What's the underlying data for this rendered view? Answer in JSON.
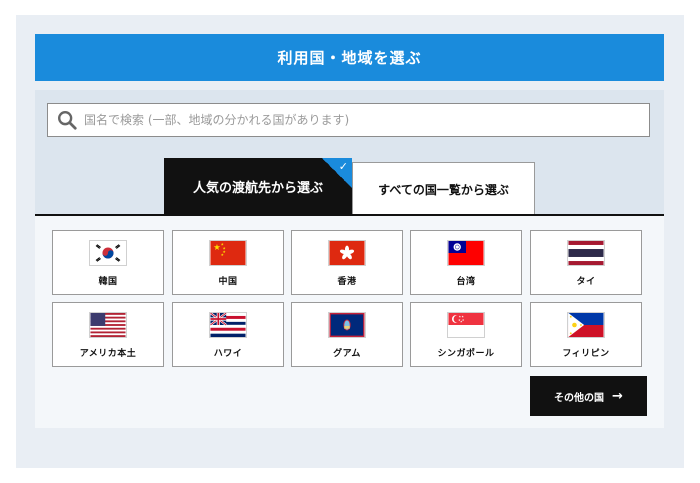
{
  "header": {
    "title": "利用国・地域を選ぶ"
  },
  "search": {
    "placeholder": "国名で検索 (一部、地域の分かれる国があります)",
    "icon": "search-icon"
  },
  "tabs": [
    {
      "label": "人気の渡航先から選ぶ",
      "active": true
    },
    {
      "label": "すべての国一覧から選ぶ",
      "active": false
    }
  ],
  "countries": [
    {
      "name": "韓国",
      "flag": "korea-flag-icon"
    },
    {
      "name": "中国",
      "flag": "china-flag-icon"
    },
    {
      "name": "香港",
      "flag": "hongkong-flag-icon"
    },
    {
      "name": "台湾",
      "flag": "taiwan-flag-icon"
    },
    {
      "name": "タイ",
      "flag": "thailand-flag-icon"
    },
    {
      "name": "アメリカ本土",
      "flag": "usa-flag-icon"
    },
    {
      "name": "ハワイ",
      "flag": "hawaii-flag-icon"
    },
    {
      "name": "グアム",
      "flag": "guam-flag-icon"
    },
    {
      "name": "シンガポール",
      "flag": "singapore-flag-icon"
    },
    {
      "name": "フィリピン",
      "flag": "philippines-flag-icon"
    }
  ],
  "other_button": {
    "label": "その他の国",
    "icon": "arrow-right-icon"
  },
  "colors": {
    "accent": "#1a8bdc",
    "dark": "#111111"
  }
}
